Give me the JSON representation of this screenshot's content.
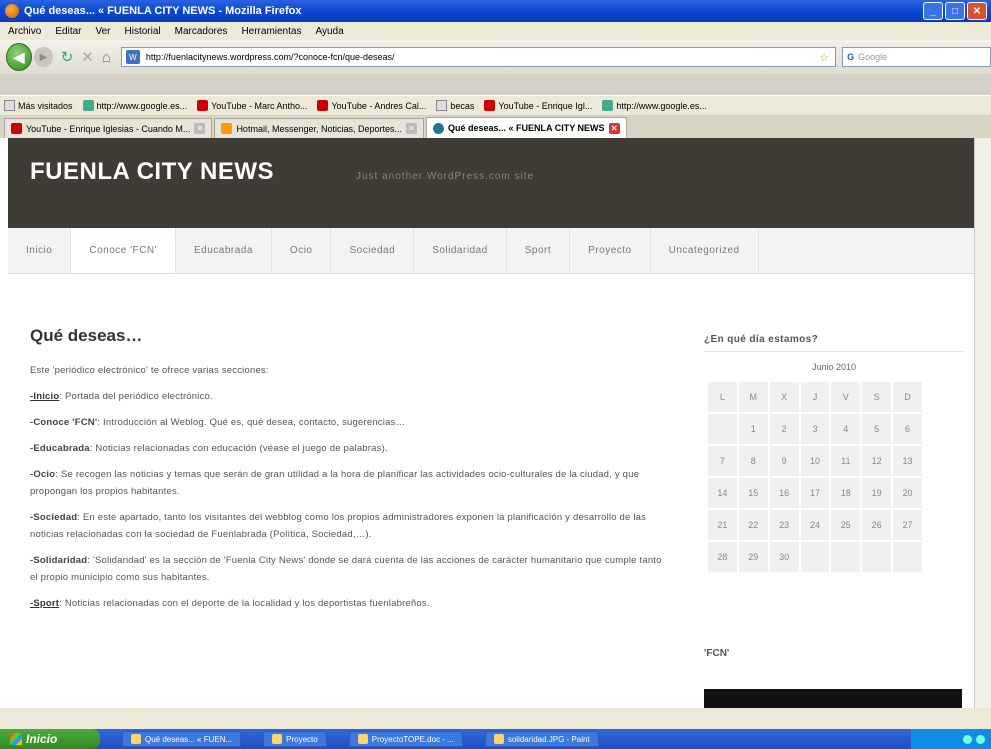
{
  "window": {
    "title": "Qué deseas... « FUENLA CITY NEWS - Mozilla Firefox",
    "buttons": [
      "_",
      "□",
      "✕"
    ]
  },
  "menu": [
    "Archivo",
    "Editar",
    "Ver",
    "Historial",
    "Marcadores",
    "Herramientas",
    "Ayuda"
  ],
  "navbar": {
    "url": "http://fuenlacitynews.wordpress.com/?conoce-fcn/que-deseas/",
    "search_placeholder": "Google"
  },
  "bookmarks": [
    {
      "label": "Más visitados",
      "icon": "globe-icon"
    },
    {
      "label": "http://www.google.es...",
      "icon": "google-icon"
    },
    {
      "label": "YouTube - Marc Antho...",
      "icon": "youtube-icon"
    },
    {
      "label": "YouTube - Andres Cal...",
      "icon": "youtube-icon"
    },
    {
      "label": "becas",
      "icon": "page-icon"
    },
    {
      "label": "YouTube - Enrique Igl...",
      "icon": "youtube-icon"
    },
    {
      "label": "http://www.google.es...",
      "icon": "google-icon"
    }
  ],
  "tabs": [
    {
      "label": "YouTube - Enrique Iglesias - Cuando M..."
    },
    {
      "label": "Hotmail, Messenger, Noticias, Deportes..."
    },
    {
      "label": "Qué deseas... « FUENLA CITY NEWS"
    }
  ],
  "site": {
    "title": "FUENLA CITY NEWS",
    "tagline": "Just another WordPress.com site",
    "nav": [
      "Inicio",
      "Conoce 'FCN'",
      "Educabrada",
      "Ocio",
      "Sociedad",
      "Solidaridad",
      "Sport",
      "Proyecto",
      "Uncategorized"
    ]
  },
  "post": {
    "heading": "Qué deseas…",
    "intro": "Este 'periódico electrónico' te ofrece varias secciones:",
    "sections": [
      {
        "name": "-Inicio",
        "text": ": Portada del periódico electrónico."
      },
      {
        "name": "-Conoce 'FCN'",
        "text": ": Introducción al Weblog. Qué es, qué desea, contacto, sugerencias…"
      },
      {
        "name": "-Educabrada",
        "text": ": Noticias relacionadas con educación (véase el juego de palabras)."
      },
      {
        "name": "-Ocio",
        "text": ": Se recogen las noticias y temas que serán de gran utilidad a la hora de planificar las actividades ocio-culturales de la ciudad, y que propongan los propios habitantes."
      },
      {
        "name": "-Sociedad",
        "text": ": En este apartado, tanto los visitantes del webblog como los propios administradores exponen la planificación y desarrollo de las noticias relacionadas con la sociedad de Fuenlabrada (Política, Sociedad,…)."
      },
      {
        "name": "-Solidaridad",
        "text": ": 'Solidaridad' es la sección de 'Fuenla City News' donde se dará cuenta de las acciones de carácter humanitario que cumple tanto el propio municipio como sus habitantes."
      },
      {
        "name": "-Sport",
        "text": ": Noticias relacionadas con el deporte de la localidad y los deportistas fuenlabreños."
      }
    ]
  },
  "sidebar": {
    "calendar_title": "¿En qué día estamos?",
    "month": "Junio 2010",
    "weekdays": [
      "L",
      "M",
      "X",
      "J",
      "V",
      "S",
      "D"
    ],
    "weeks": [
      [
        "",
        "1",
        "2",
        "3",
        "4",
        "5",
        "6"
      ],
      [
        "7",
        "8",
        "9",
        "10",
        "11",
        "12",
        "13"
      ],
      [
        "14",
        "15",
        "16",
        "17",
        "18",
        "19",
        "20"
      ],
      [
        "21",
        "22",
        "23",
        "24",
        "25",
        "26",
        "27"
      ],
      [
        "28",
        "29",
        "30",
        "",
        "",
        "",
        ""
      ]
    ],
    "fcn_title": "'FCN'"
  },
  "taskbar": {
    "start": "Inicio",
    "tasks": [
      "Qué deseas... « FUEN...",
      "Proyecto",
      "ProyectoTOPE.doc - ...",
      "solidaridad.JPG - Paint"
    ]
  }
}
